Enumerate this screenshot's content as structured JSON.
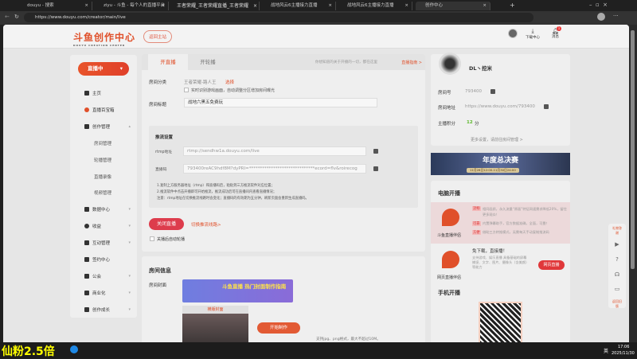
{
  "browser": {
    "tabs": [
      "douyu - 搜索",
      "ziyu - 斗鱼 - 每个人的直播平台",
      "王者荣耀_王者荣耀直播_王者荣耀",
      "战地风云6主播接力直播",
      "战地风云6主播接力直播",
      "创作中心"
    ],
    "url": "https://www.douyu.com/creator/main/live"
  },
  "header": {
    "logo": "斗鱼创作中心",
    "logo_sub": "DOUYU CREATION CENTER",
    "back": "返回主站",
    "download": "下载中心",
    "messages": "消息",
    "msg_count": "1"
  },
  "sidebar": {
    "live_btn": "直播中",
    "items": [
      {
        "label": "主页"
      },
      {
        "label": "直播百宝箱"
      },
      {
        "label": "创作管理"
      },
      {
        "label": "数据中心"
      },
      {
        "label": "收益"
      },
      {
        "label": "互动管理"
      },
      {
        "label": "签约中心"
      },
      {
        "label": "公会"
      },
      {
        "label": "商业化"
      },
      {
        "label": "创作成长"
      }
    ],
    "sub": [
      "房间管理",
      "轮播管理",
      "直播录像",
      "视频管理"
    ]
  },
  "main": {
    "tabs": [
      "开直播",
      "开轮播"
    ],
    "hint": "你想知道的关于开播的一切，都在这里",
    "guide": "直播指南 >",
    "category_label": "房间分类",
    "category": "王者荣耀-路人王",
    "choose": "选择",
    "auto_detect": "实时识别游戏画面，自动调整分区增加房间曝光",
    "title_label": "房间标题",
    "title": "战地六黑五免费玩",
    "push": {
      "heading": "推流设置",
      "rtmp_label": "rtmp地址",
      "rtmp": "rtmp://sendhw1a.douyu.com/live",
      "code_label": "直播码",
      "code": "793400reAC9hdf8M?dyPRI=******************************ecord=flv&roirecog",
      "notes": [
        "1.复制上方服务器地址（rtmp）和直播码后，粘贴到三方推流软件对应位置；",
        "2.推流软件中点击开播即可开始推流，推流成功后可在直播间内查看直播情况；",
        "注意：rtmp地址在切换推流线路时会变化；直播码的有效期为五分钟，刷新页面会重新生成直播码。"
      ]
    },
    "close_btn": "关闭直播",
    "switch_line": "切换推流线路>",
    "auto_rotate": "关播后自动轮播"
  },
  "room_info": {
    "heading": "房间信息",
    "cover_label": "房间封面",
    "banner": "斗鱼直播 热门封面制作指南",
    "cover_tab": "横版封面",
    "make_btn": "开始制作",
    "support": "支持jpg、png格式，最大不超过10M。"
  },
  "profile": {
    "name": "DL丶挖米",
    "room_no_label": "房间号",
    "room_no": "793400",
    "addr_label": "房间地址",
    "addr": "https://www.douyu.com/793400",
    "score_label": "主播积分",
    "score": "12",
    "score_unit": "分",
    "more": "更多设置，请前往房间管理 >"
  },
  "event_banner": {
    "title": "年度总决赛",
    "date": "11月26日12:00-11月30日24:00"
  },
  "pc_live": {
    "heading": "电脑开播",
    "app": "斗鱼直播伴侣",
    "tags": [
      "流畅",
      "可靠",
      "方便"
    ],
    "lines": [
      "相同画质，永久流量“原画”特征网速需求降低20%，留住更多观众！",
      "内置弹幕助手，官方数据准确，全面，可靠！",
      "借助三方转推模式，无需每天手动复制推流码"
    ],
    "web_app": "网页直播伴侣",
    "web_title": "免下载，直接播！",
    "web_desc": "支持游戏、娱乐直播 具备基础的屏幕捕捉、文字、图片、摄像头（含美颜）等能力",
    "web_btn": "网页直播"
  },
  "mobile_live": {
    "heading": "手机开播"
  },
  "tools": {
    "gift": "礼物答谢",
    "back_old": "返回旧版"
  },
  "taskbar": {
    "overlay": "仙粉2.5倍",
    "time": "17:06",
    "date": "2025/11/30",
    "ime": "英"
  }
}
